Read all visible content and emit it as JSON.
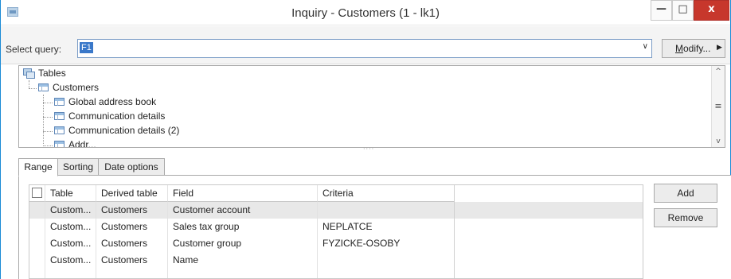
{
  "window": {
    "title": "Inquiry - Customers (1 - lk1)",
    "min_glyph": "—",
    "max_glyph": "□",
    "close_glyph": "x"
  },
  "query": {
    "label": "Select query:",
    "value": "F1",
    "modify_label_underlined": "M",
    "modify_label_rest": "odify...",
    "dropdown_glyph": "∨",
    "modify_arrow_glyph": "▶"
  },
  "tree": {
    "root": "Tables",
    "table": "Customers",
    "children": [
      "Global address book",
      "Communication details",
      "Communication details (2)",
      "Addr..."
    ]
  },
  "tabs": [
    "Range",
    "Sorting",
    "Date options"
  ],
  "grid": {
    "columns": [
      "Table",
      "Derived table",
      "Field",
      "Criteria"
    ],
    "rows": [
      {
        "table": "Custom...",
        "derived": "Customers",
        "field": "Customer account",
        "criteria": ""
      },
      {
        "table": "Custom...",
        "derived": "Customers",
        "field": "Sales tax group",
        "criteria": "NEPLATCE"
      },
      {
        "table": "Custom...",
        "derived": "Customers",
        "field": "Customer group",
        "criteria": "FYZICKE-OSOBY"
      },
      {
        "table": "Custom...",
        "derived": "Customers",
        "field": "Name",
        "criteria": ""
      }
    ]
  },
  "buttons": {
    "add": "Add",
    "remove": "Remove"
  },
  "colors": {
    "window_border": "#1a8ad6",
    "close_button": "#c7372c",
    "selection": "#3a78c9"
  }
}
